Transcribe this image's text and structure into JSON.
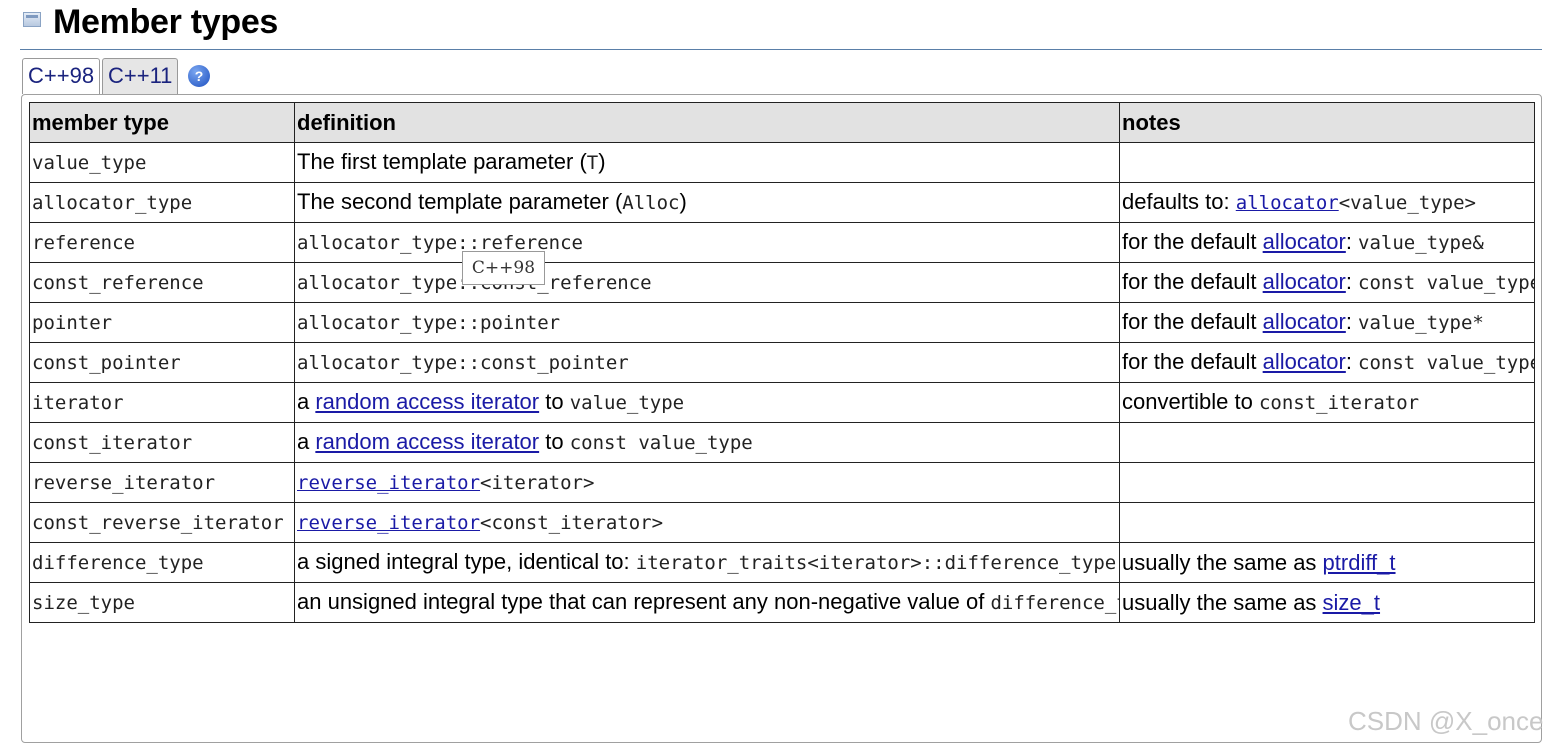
{
  "section": {
    "title": "Member types",
    "icon": "section-icon"
  },
  "tabs": [
    {
      "label": "C++98",
      "active": true
    },
    {
      "label": "C++11",
      "active": false
    }
  ],
  "help": {
    "label": "?"
  },
  "table": {
    "headers": [
      "member type",
      "definition",
      "notes"
    ],
    "rows": [
      {
        "member": "value_type",
        "definition": [
          {
            "t": "text",
            "v": "The first template parameter ("
          },
          {
            "t": "code",
            "v": "T"
          },
          {
            "t": "text",
            "v": ")"
          }
        ],
        "notes": []
      },
      {
        "member": "allocator_type",
        "definition": [
          {
            "t": "text",
            "v": "The second template parameter ("
          },
          {
            "t": "code",
            "v": "Alloc"
          },
          {
            "t": "text",
            "v": ")"
          }
        ],
        "notes": [
          {
            "t": "text",
            "v": "defaults to: "
          },
          {
            "t": "codelink",
            "v": "allocator"
          },
          {
            "t": "code",
            "v": "<value_type>"
          }
        ]
      },
      {
        "member": "reference",
        "definition": [
          {
            "t": "code",
            "v": "allocator_type::reference"
          }
        ],
        "notes": [
          {
            "t": "text",
            "v": "for the default "
          },
          {
            "t": "link",
            "v": "allocator"
          },
          {
            "t": "text",
            "v": ": "
          },
          {
            "t": "code",
            "v": "value_type&"
          }
        ]
      },
      {
        "member": "const_reference",
        "definition": [
          {
            "t": "code",
            "v": "allocator_type::const_reference"
          }
        ],
        "notes": [
          {
            "t": "text",
            "v": "for the default "
          },
          {
            "t": "link",
            "v": "allocator"
          },
          {
            "t": "text",
            "v": ": "
          },
          {
            "t": "code",
            "v": "const value_type&"
          }
        ],
        "wrap": true
      },
      {
        "member": "pointer",
        "definition": [
          {
            "t": "code",
            "v": "allocator_type::pointer"
          }
        ],
        "notes": [
          {
            "t": "text",
            "v": "for the default "
          },
          {
            "t": "link",
            "v": "allocator"
          },
          {
            "t": "text",
            "v": ": "
          },
          {
            "t": "code",
            "v": "value_type*"
          }
        ]
      },
      {
        "member": "const_pointer",
        "definition": [
          {
            "t": "code",
            "v": "allocator_type::const_pointer"
          }
        ],
        "notes": [
          {
            "t": "text",
            "v": "for the default "
          },
          {
            "t": "link",
            "v": "allocator"
          },
          {
            "t": "text",
            "v": ": "
          },
          {
            "t": "code",
            "v": "const value_type*"
          }
        ],
        "wrap": true
      },
      {
        "member": "iterator",
        "definition": [
          {
            "t": "text",
            "v": "a "
          },
          {
            "t": "link",
            "v": "random access iterator"
          },
          {
            "t": "text",
            "v": " to "
          },
          {
            "t": "code",
            "v": "value_type"
          }
        ],
        "notes": [
          {
            "t": "text",
            "v": "convertible to "
          },
          {
            "t": "code",
            "v": "const_iterator"
          }
        ]
      },
      {
        "member": "const_iterator",
        "definition": [
          {
            "t": "text",
            "v": "a "
          },
          {
            "t": "link",
            "v": "random access iterator"
          },
          {
            "t": "text",
            "v": " to "
          },
          {
            "t": "code",
            "v": "const value_type"
          }
        ],
        "notes": []
      },
      {
        "member": "reverse_iterator",
        "definition": [
          {
            "t": "codelink",
            "v": "reverse_iterator"
          },
          {
            "t": "code",
            "v": "<iterator>"
          }
        ],
        "notes": []
      },
      {
        "member": "const_reverse_iterator",
        "definition": [
          {
            "t": "codelink",
            "v": "reverse_iterator"
          },
          {
            "t": "code",
            "v": "<const_iterator>"
          }
        ],
        "notes": []
      },
      {
        "member": "difference_type",
        "definition": [
          {
            "t": "text",
            "v": "a signed integral type, identical to: "
          },
          {
            "t": "code",
            "v": "iterator_traits<iterator>::difference_type"
          }
        ],
        "notes": [
          {
            "t": "text",
            "v": "usually the same as "
          },
          {
            "t": "link",
            "v": "ptrdiff_t"
          }
        ],
        "wrap": true
      },
      {
        "member": "size_type",
        "definition": [
          {
            "t": "text",
            "v": "an unsigned integral type that can represent any non-negative value of "
          },
          {
            "t": "code",
            "v": "difference_type"
          }
        ],
        "notes": [
          {
            "t": "text",
            "v": "usually the same as "
          },
          {
            "t": "link",
            "v": "size_t"
          }
        ],
        "wrap": true
      }
    ]
  },
  "tooltip": {
    "text": "C++98"
  },
  "watermark": {
    "text": "CSDN @X_once"
  }
}
